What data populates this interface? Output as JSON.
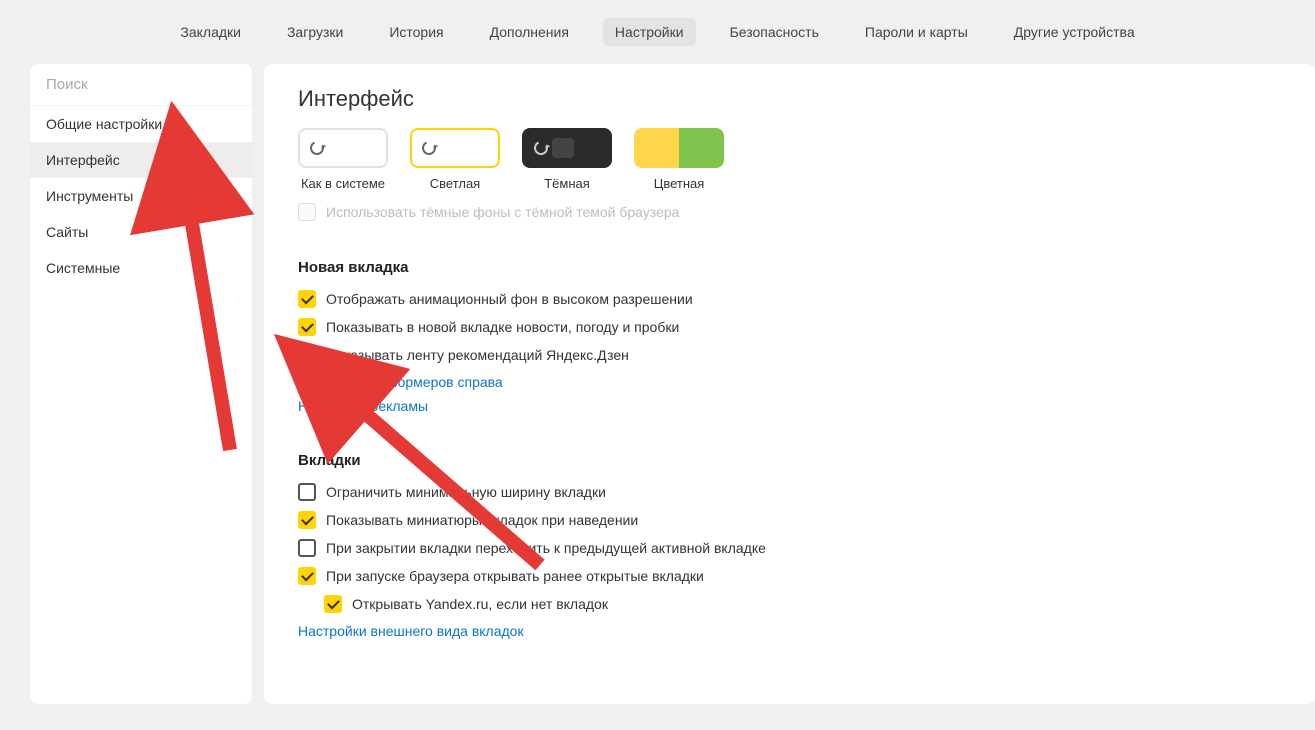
{
  "topnav": {
    "tabs": [
      "Закладки",
      "Загрузки",
      "История",
      "Дополнения",
      "Настройки",
      "Безопасность",
      "Пароли и карты",
      "Другие устройства"
    ],
    "active_index": 4
  },
  "sidebar": {
    "search_placeholder": "Поиск",
    "items": [
      "Общие настройки",
      "Интерфейс",
      "Инструменты",
      "Сайты",
      "Системные"
    ],
    "active_index": 1
  },
  "page": {
    "title": "Интерфейс",
    "themes": {
      "system": "Как в системе",
      "light": "Светлая",
      "dark": "Тёмная",
      "color": "Цветная"
    },
    "disabled_dark_backgrounds": "Использовать тёмные фоны с тёмной темой браузера",
    "newtab": {
      "title": "Новая вкладка",
      "hi_res_bg": "Отображать анимационный фон в высоком разрешении",
      "show_news": "Показывать в новой вкладке новости, погоду и пробки",
      "show_zen": "Показывать ленту рекомендаций Яндекс.Дзен",
      "informers_link": "Настройки информеров справа",
      "ads_link": "Настройки рекламы"
    },
    "tabs_section": {
      "title": "Вкладки",
      "min_width": "Ограничить минимальную ширину вкладки",
      "thumbnails": "Показывать миниатюры вкладок при наведении",
      "prev_active": "При закрытии вкладки переходить к предыдущей активной вкладке",
      "restore": "При запуске браузера открывать ранее открытые вкладки",
      "open_yandex": "Открывать Yandex.ru, если нет вкладок",
      "appearance_link": "Настройки внешнего вида вкладок"
    }
  }
}
